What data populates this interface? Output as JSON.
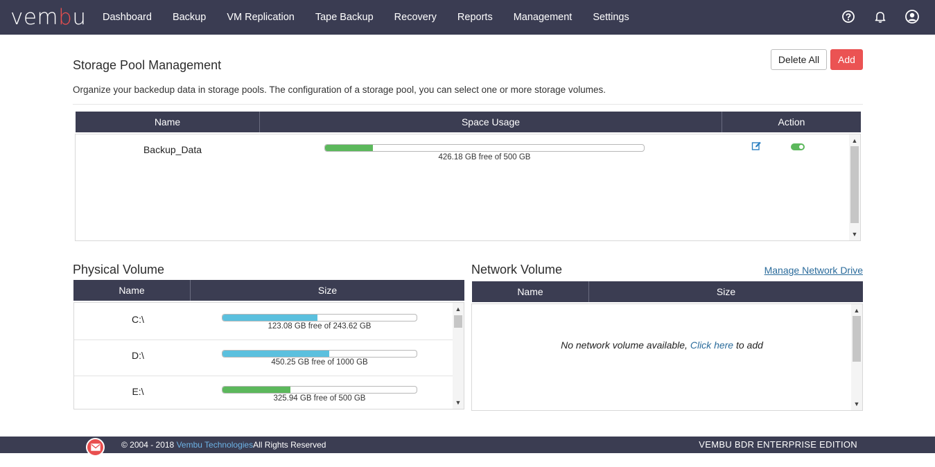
{
  "logo": {
    "text_main": "vem",
    "text_accent": "b",
    "text_tail": "u"
  },
  "nav": {
    "items": [
      "Dashboard",
      "Backup",
      "VM Replication",
      "Tape Backup",
      "Recovery",
      "Reports",
      "Management",
      "Settings"
    ]
  },
  "top_icons": [
    "help-icon",
    "bell-icon",
    "user-icon"
  ],
  "page": {
    "title": "Storage Pool Management",
    "description": "Organize your backedup data in storage pools. The configuration of a storage pool, you can select one or more storage volumes.",
    "delete_all_label": "Delete All",
    "add_label": "Add"
  },
  "storage_pool_table": {
    "columns": [
      "Name",
      "Space Usage",
      "Action"
    ],
    "rows": [
      {
        "name": "Backup_Data",
        "usage_text": "426.18 GB free of 500 GB",
        "used_fraction": 0.15,
        "bar_color": "#5cb85c",
        "enabled": true
      }
    ]
  },
  "physical_volume": {
    "title": "Physical Volume",
    "columns": [
      "Name",
      "Size"
    ],
    "rows": [
      {
        "name": "C:\\",
        "usage_text": "123.08 GB free of 243.62 GB",
        "used_fraction": 0.49,
        "bar_color": "#5bc0de"
      },
      {
        "name": "D:\\",
        "usage_text": "450.25 GB free of 1000 GB",
        "used_fraction": 0.55,
        "bar_color": "#5bc0de"
      },
      {
        "name": "E:\\",
        "usage_text": "325.94 GB free of 500 GB",
        "used_fraction": 0.35,
        "bar_color": "#5cb85c"
      }
    ]
  },
  "network_volume": {
    "title": "Network Volume",
    "manage_link": "Manage Network Drive",
    "columns": [
      "Name",
      "Size"
    ],
    "empty_prefix": "No network volume available,",
    "empty_link": "Click here",
    "empty_suffix": "to add"
  },
  "footer": {
    "copyright_prefix": "© 2004 - 2018",
    "company_link": "Vembu Technologies",
    "copyright_suffix": "All Rights Reserved",
    "edition": "VEMBU BDR ENTERPRISE EDITION"
  },
  "colors": {
    "header_bg": "#3a3c52",
    "accent_red": "#eb5353",
    "link_blue": "#2a6b9b"
  }
}
